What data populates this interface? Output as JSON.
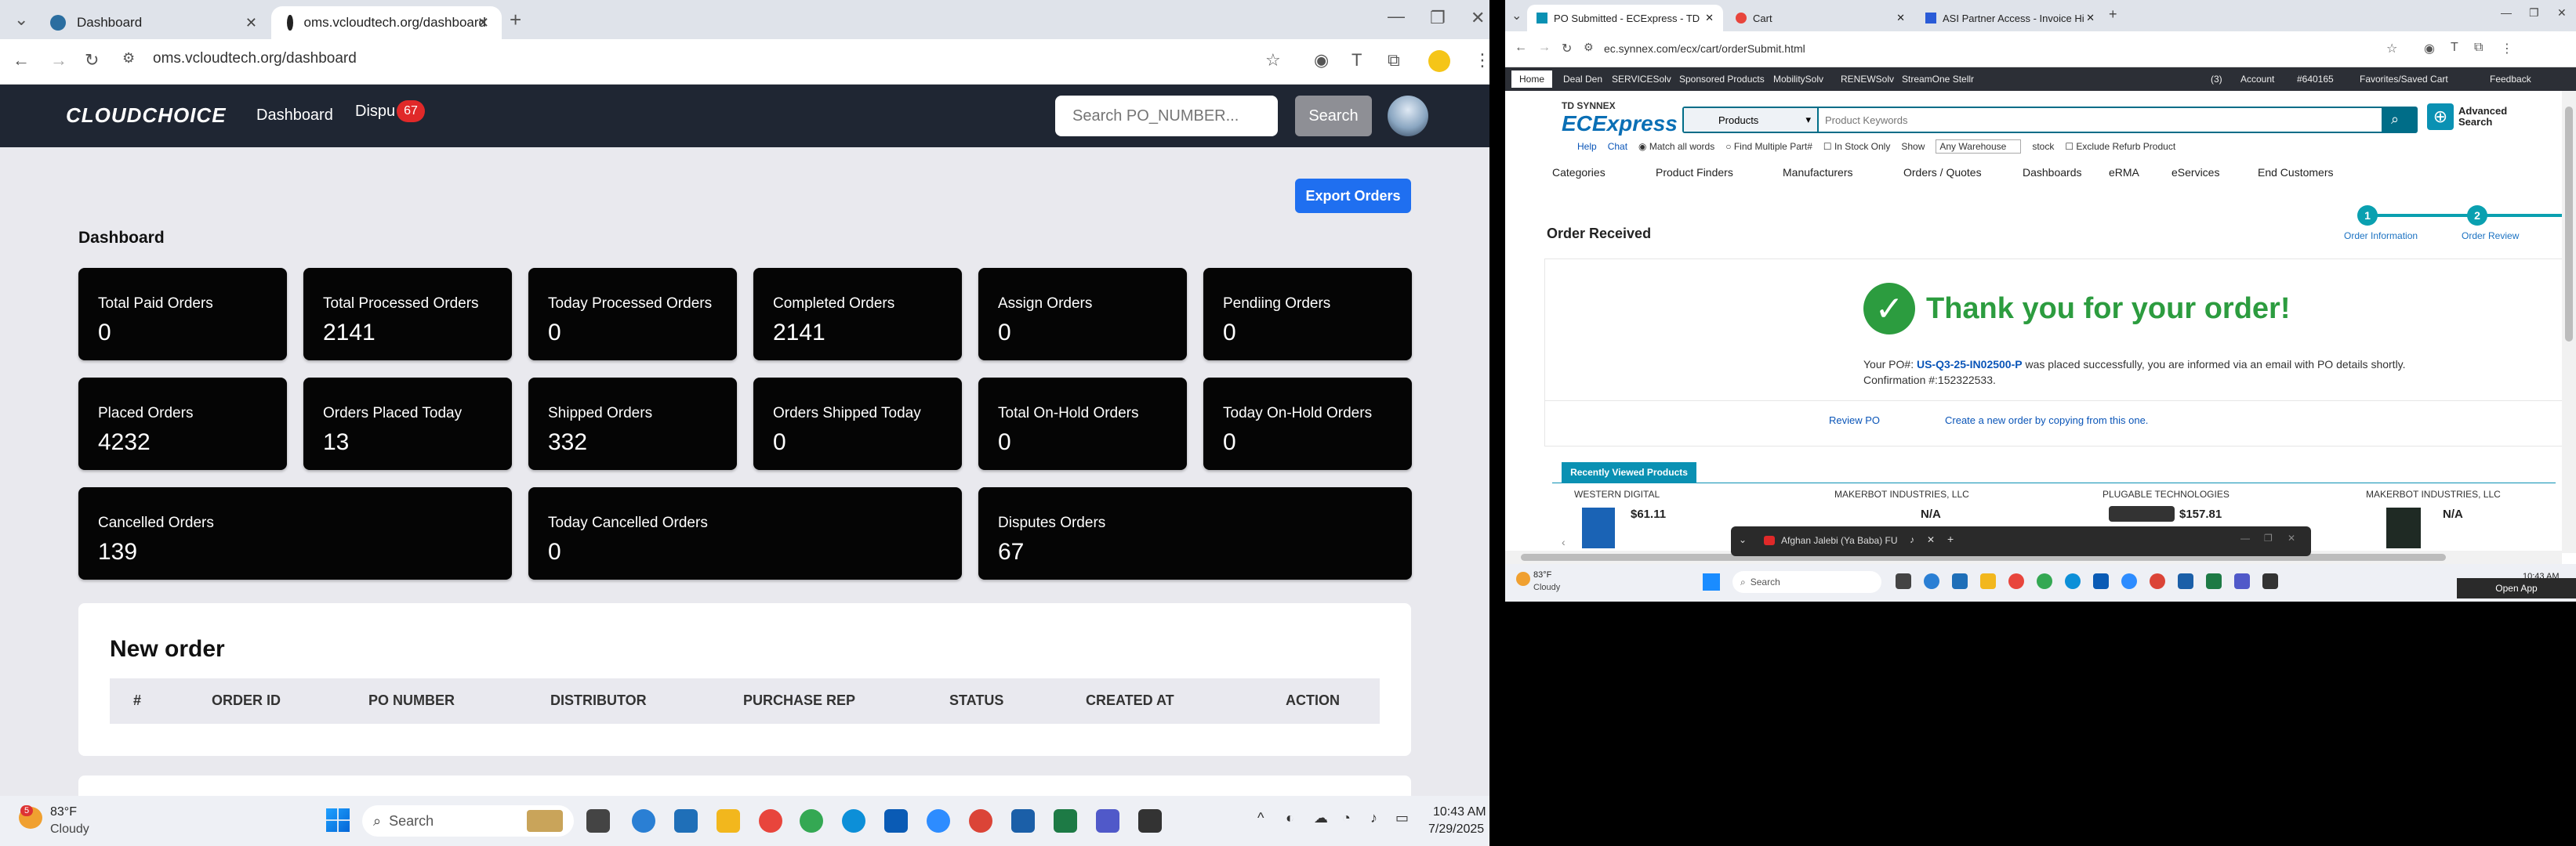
{
  "left": {
    "tabs": [
      {
        "title": "Dashboard",
        "favicon": "#2b6ea0"
      },
      {
        "title": "oms.vcloudtech.org/dashboard",
        "favicon": "#222222"
      }
    ],
    "url": "oms.vcloudtech.org/dashboard",
    "app": {
      "logo": "CLOUDCHOICE",
      "nav_dashboard": "Dashboard",
      "nav_disputes": "Dispu",
      "disputes_badge": "67",
      "search_placeholder": "Search PO_NUMBER...",
      "search_button": "Search"
    },
    "export_button": "Export Orders",
    "dashboard_title": "Dashboard",
    "cards": [
      {
        "label": "Total Paid Orders",
        "value": "0"
      },
      {
        "label": "Total Processed Orders",
        "value": "2141"
      },
      {
        "label": "Today Processed Orders",
        "value": "0"
      },
      {
        "label": "Completed Orders",
        "value": "2141"
      },
      {
        "label": "Assign Orders",
        "value": "0"
      },
      {
        "label": "Pendiing Orders",
        "value": "0"
      },
      {
        "label": "Placed Orders",
        "value": "4232"
      },
      {
        "label": "Orders Placed Today",
        "value": "13"
      },
      {
        "label": "Shipped Orders",
        "value": "332"
      },
      {
        "label": "Orders Shipped Today",
        "value": "0"
      },
      {
        "label": "Total On-Hold Orders",
        "value": "0"
      },
      {
        "label": "Today On-Hold Orders",
        "value": "0"
      },
      {
        "label": "Cancelled Orders",
        "value": "139"
      },
      {
        "label": "Today Cancelled Orders",
        "value": "0"
      },
      {
        "label": "Disputes Orders",
        "value": "67"
      }
    ],
    "new_order": {
      "title": "New order",
      "columns": [
        "#",
        "ORDER ID",
        "PO NUMBER",
        "DISTRIBUTOR",
        "PURCHASE REP",
        "STATUS",
        "CREATED AT",
        "ACTION"
      ]
    },
    "taskbar": {
      "weather_temp": "83°F",
      "weather_desc": "Cloudy",
      "weather_badge": "5",
      "search_label": "Search",
      "time": "10:43 AM",
      "date": "7/29/2025"
    }
  },
  "right": {
    "tabs": [
      {
        "title": "PO Submitted - ECExpress - TD"
      },
      {
        "title": "Cart"
      },
      {
        "title": "ASI Partner Access - Invoice Hi"
      }
    ],
    "url": "ec.synnex.com/ecx/cart/orderSubmit.html",
    "topbar": [
      "Home",
      "Deal Den",
      "SERVICESolv",
      "Sponsored Products",
      "MobilitySolv",
      "RENEWSolv",
      "StreamOne Stellr"
    ],
    "topbar_right": {
      "msg": "(3)",
      "account": "Account",
      "acct_no": "#640165",
      "favorites": "Favorites/Saved Cart",
      "feedback": "Feedback"
    },
    "logo_small": "TD SYNNEX",
    "logo_big": "ECExpress",
    "search_category": "Products",
    "search_placeholder": "Product Keywords",
    "advanced_search": "Advanced Search",
    "sub": {
      "help": "Help",
      "chat": "Chat",
      "match_all": "Match all words",
      "find_multiple": "Find Multiple Part#",
      "in_stock": "In Stock Only",
      "show": "Show",
      "warehouse": "Any Warehouse",
      "stock": "stock",
      "exclude": "Exclude Refurb Product"
    },
    "menu": [
      "Categories",
      "Product Finders",
      "Manufacturers",
      "Orders / Quotes",
      "Dashboards",
      "eRMA",
      "eServices",
      "End Customers"
    ],
    "order_title": "Order Received",
    "steps": [
      {
        "num": "1",
        "label": "Order Information"
      },
      {
        "num": "2",
        "label": "Order Review"
      }
    ],
    "thank_you": "Thank you for your order!",
    "po_prefix": "Your PO#:",
    "po_number": "US-Q3-25-IN02500-P",
    "po_suffix": "was placed successfully, you are informed via an email with PO details shortly. Confirmation #:152322533.",
    "review_po": "Review PO",
    "create_new": "Create a new order by copying from this one.",
    "recently_viewed": "Recently Viewed Products",
    "products": [
      {
        "maker": "WESTERN DIGITAL",
        "price": "$61.11"
      },
      {
        "maker": "MAKERBOT INDUSTRIES, LLC",
        "price": "N/A"
      },
      {
        "maker": "PLUGABLE TECHNOLOGIES",
        "price": "$157.81"
      },
      {
        "maker": "MAKERBOT INDUSTRIES, LLC",
        "price": "N/A"
      }
    ],
    "popup_title": "Afghan Jalebi (Ya Baba) FU",
    "taskbar": {
      "weather_temp": "83°F",
      "weather_desc": "Cloudy",
      "search_label": "Search",
      "time": "10:43 AM",
      "open_app": "Open App"
    }
  }
}
